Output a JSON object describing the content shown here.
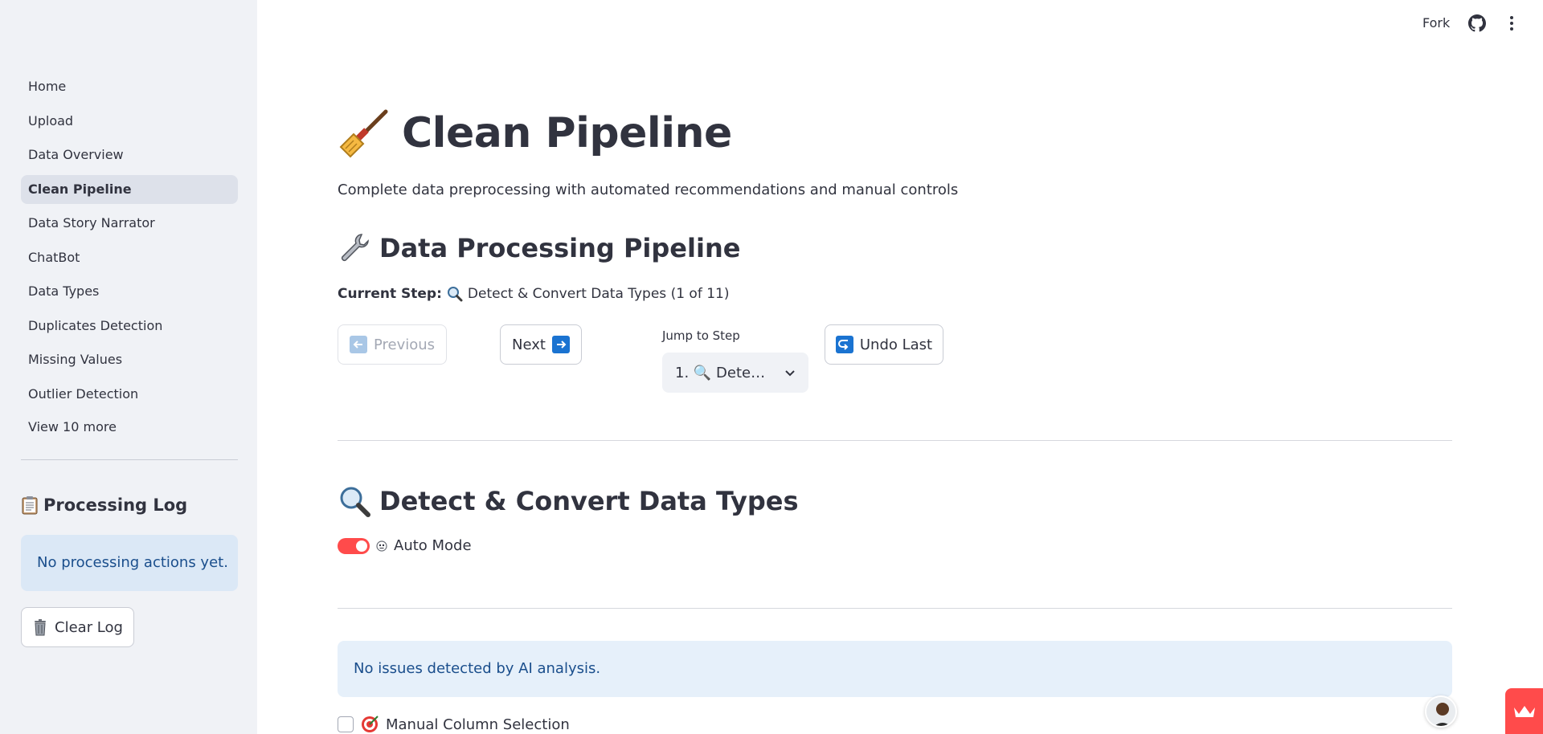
{
  "sidebar": {
    "nav_items": [
      {
        "label": "Home",
        "active": false
      },
      {
        "label": "Upload",
        "active": false
      },
      {
        "label": "Data Overview",
        "active": false
      },
      {
        "label": "Clean Pipeline",
        "active": true
      },
      {
        "label": "Data Story Narrator",
        "active": false
      },
      {
        "label": "ChatBot",
        "active": false
      },
      {
        "label": "Data Types",
        "active": false
      },
      {
        "label": "Duplicates Detection",
        "active": false
      },
      {
        "label": "Missing Values",
        "active": false
      },
      {
        "label": "Outlier Detection",
        "active": false
      }
    ],
    "view_more": "View 10 more",
    "log_title": "Processing Log",
    "log_icon": "clipboard-icon",
    "log_empty": "No processing actions yet.",
    "clear_log": "Clear Log",
    "clear_icon": "trash-icon"
  },
  "header": {
    "fork": "Fork",
    "github_icon": "github-icon",
    "menu_icon": "kebab-menu-icon"
  },
  "main": {
    "title": "Clean Pipeline",
    "title_icon": "broom-icon",
    "subtitle": "Complete data preprocessing with automated recommendations and manual controls",
    "section_title": "Data Processing Pipeline",
    "section_icon": "wrench-icon",
    "current_step_label": "Current Step:",
    "current_step_value": "Detect & Convert Data Types (1 of 11)",
    "prev_label": "Previous",
    "next_label": "Next",
    "jump_label": "Jump to Step",
    "jump_value": "1. 🔍 Dete…",
    "undo_label": "Undo Last",
    "step_title": "Detect & Convert Data Types",
    "auto_mode_label": "Auto Mode",
    "auto_mode_on": true,
    "ai_info": "No issues detected by AI analysis.",
    "manual_selection_label": "Manual Column Selection"
  },
  "colors": {
    "accent": "#ff4b4b",
    "sidebar_bg": "#f0f2f6",
    "info_bg": "#e6f0fa",
    "info_text": "#1a4e8c"
  }
}
